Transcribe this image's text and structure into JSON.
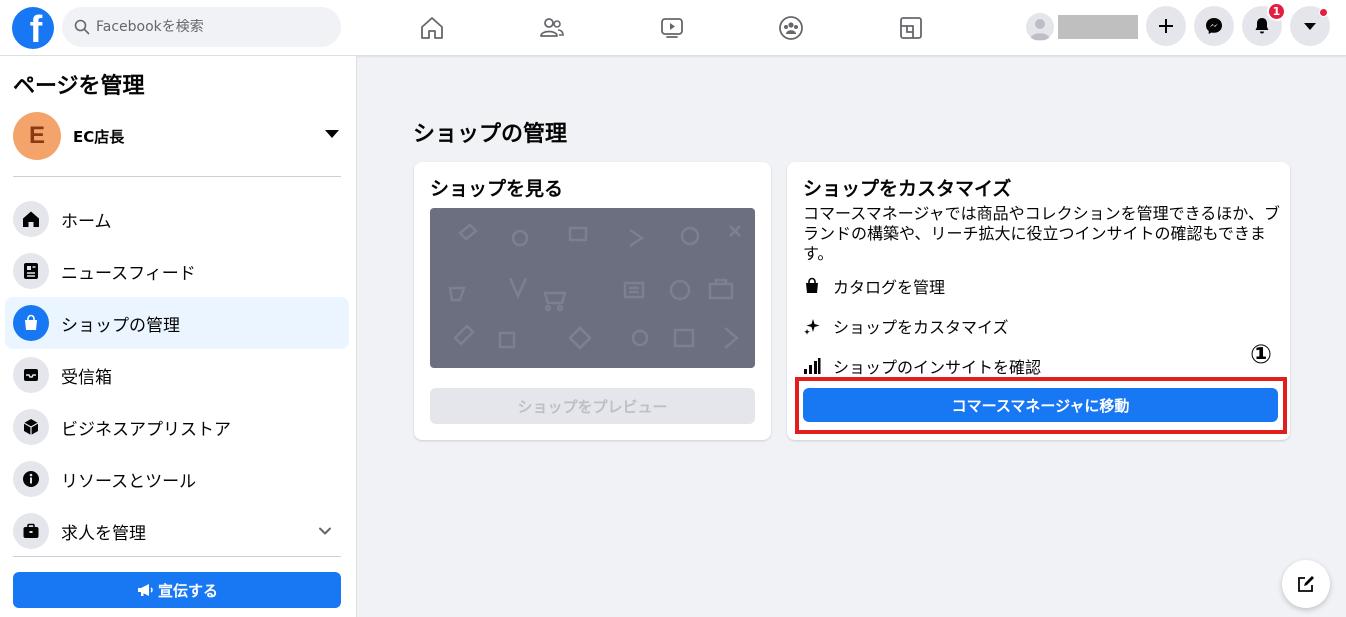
{
  "topbar": {
    "logo_letter": "f",
    "search_placeholder": "Facebookを検索",
    "nav_icons": [
      "home-icon",
      "friends-icon",
      "watch-icon",
      "groups-icon",
      "gaming-icon"
    ],
    "notification_count": "1"
  },
  "sidebar": {
    "title": "ページを管理",
    "page": {
      "avatar_letter": "E",
      "name": "EC店長"
    },
    "items": [
      {
        "label": "ホーム",
        "icon": "home-icon",
        "active": false
      },
      {
        "label": "ニュースフィード",
        "icon": "news-feed-icon",
        "active": false
      },
      {
        "label": "ショップの管理",
        "icon": "shopping-bag-icon",
        "active": true
      },
      {
        "label": "受信箱",
        "icon": "inbox-icon",
        "active": false
      },
      {
        "label": "ビジネスアプリストア",
        "icon": "cube-icon",
        "active": false
      },
      {
        "label": "リソースとツール",
        "icon": "info-icon",
        "active": false
      },
      {
        "label": "求人を管理",
        "icon": "briefcase-icon",
        "active": false
      }
    ],
    "promote_label": "宣伝する"
  },
  "main": {
    "title": "ショップの管理",
    "view_card": {
      "title": "ショップを見る",
      "preview_button": "ショップをプレビュー"
    },
    "customize_card": {
      "title": "ショップをカスタマイズ",
      "description": "コマースマネージャでは商品やコレクションを管理できるほか、ブランドの構築や、リーチ拡大に役立つインサイトの確認もできます。",
      "features": [
        {
          "label": "カタログを管理",
          "icon": "bag-icon"
        },
        {
          "label": "ショップをカスタマイズ",
          "icon": "sparkle-icon"
        },
        {
          "label": "ショップのインサイトを確認",
          "icon": "bar-chart-icon"
        }
      ],
      "commerce_button": "コマースマネージャに移動"
    },
    "step_marker": "①"
  },
  "colors": {
    "accent": "#1877f2",
    "highlight": "#e01e1e",
    "badge": "#e41e3f"
  }
}
